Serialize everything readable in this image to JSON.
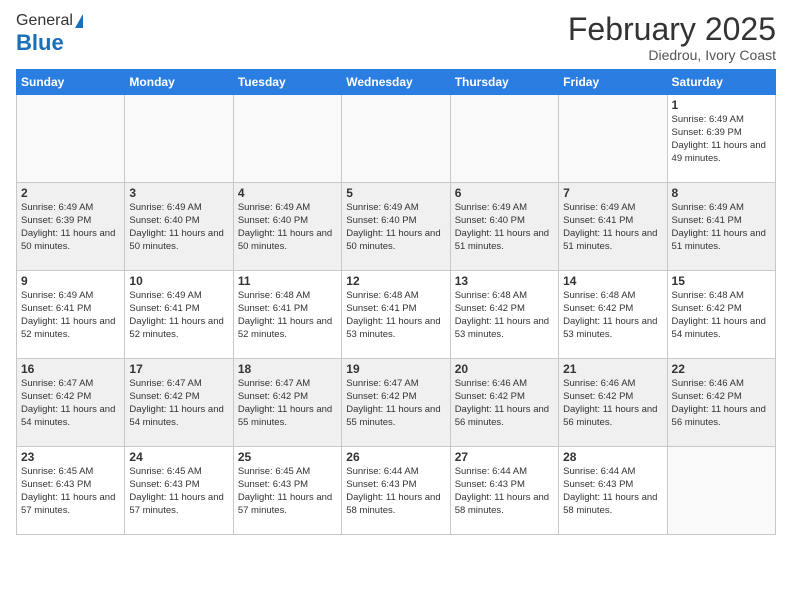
{
  "logo": {
    "general": "General",
    "blue": "Blue"
  },
  "header": {
    "title": "February 2025",
    "subtitle": "Diedrou, Ivory Coast"
  },
  "days_of_week": [
    "Sunday",
    "Monday",
    "Tuesday",
    "Wednesday",
    "Thursday",
    "Friday",
    "Saturday"
  ],
  "weeks": [
    [
      {
        "day": "",
        "info": ""
      },
      {
        "day": "",
        "info": ""
      },
      {
        "day": "",
        "info": ""
      },
      {
        "day": "",
        "info": ""
      },
      {
        "day": "",
        "info": ""
      },
      {
        "day": "",
        "info": ""
      },
      {
        "day": "1",
        "info": "Sunrise: 6:49 AM\nSunset: 6:39 PM\nDaylight: 11 hours and 49 minutes."
      }
    ],
    [
      {
        "day": "2",
        "info": "Sunrise: 6:49 AM\nSunset: 6:39 PM\nDaylight: 11 hours and 50 minutes."
      },
      {
        "day": "3",
        "info": "Sunrise: 6:49 AM\nSunset: 6:40 PM\nDaylight: 11 hours and 50 minutes."
      },
      {
        "day": "4",
        "info": "Sunrise: 6:49 AM\nSunset: 6:40 PM\nDaylight: 11 hours and 50 minutes."
      },
      {
        "day": "5",
        "info": "Sunrise: 6:49 AM\nSunset: 6:40 PM\nDaylight: 11 hours and 50 minutes."
      },
      {
        "day": "6",
        "info": "Sunrise: 6:49 AM\nSunset: 6:40 PM\nDaylight: 11 hours and 51 minutes."
      },
      {
        "day": "7",
        "info": "Sunrise: 6:49 AM\nSunset: 6:41 PM\nDaylight: 11 hours and 51 minutes."
      },
      {
        "day": "8",
        "info": "Sunrise: 6:49 AM\nSunset: 6:41 PM\nDaylight: 11 hours and 51 minutes."
      }
    ],
    [
      {
        "day": "9",
        "info": "Sunrise: 6:49 AM\nSunset: 6:41 PM\nDaylight: 11 hours and 52 minutes."
      },
      {
        "day": "10",
        "info": "Sunrise: 6:49 AM\nSunset: 6:41 PM\nDaylight: 11 hours and 52 minutes."
      },
      {
        "day": "11",
        "info": "Sunrise: 6:48 AM\nSunset: 6:41 PM\nDaylight: 11 hours and 52 minutes."
      },
      {
        "day": "12",
        "info": "Sunrise: 6:48 AM\nSunset: 6:41 PM\nDaylight: 11 hours and 53 minutes."
      },
      {
        "day": "13",
        "info": "Sunrise: 6:48 AM\nSunset: 6:42 PM\nDaylight: 11 hours and 53 minutes."
      },
      {
        "day": "14",
        "info": "Sunrise: 6:48 AM\nSunset: 6:42 PM\nDaylight: 11 hours and 53 minutes."
      },
      {
        "day": "15",
        "info": "Sunrise: 6:48 AM\nSunset: 6:42 PM\nDaylight: 11 hours and 54 minutes."
      }
    ],
    [
      {
        "day": "16",
        "info": "Sunrise: 6:47 AM\nSunset: 6:42 PM\nDaylight: 11 hours and 54 minutes."
      },
      {
        "day": "17",
        "info": "Sunrise: 6:47 AM\nSunset: 6:42 PM\nDaylight: 11 hours and 54 minutes."
      },
      {
        "day": "18",
        "info": "Sunrise: 6:47 AM\nSunset: 6:42 PM\nDaylight: 11 hours and 55 minutes."
      },
      {
        "day": "19",
        "info": "Sunrise: 6:47 AM\nSunset: 6:42 PM\nDaylight: 11 hours and 55 minutes."
      },
      {
        "day": "20",
        "info": "Sunrise: 6:46 AM\nSunset: 6:42 PM\nDaylight: 11 hours and 56 minutes."
      },
      {
        "day": "21",
        "info": "Sunrise: 6:46 AM\nSunset: 6:42 PM\nDaylight: 11 hours and 56 minutes."
      },
      {
        "day": "22",
        "info": "Sunrise: 6:46 AM\nSunset: 6:42 PM\nDaylight: 11 hours and 56 minutes."
      }
    ],
    [
      {
        "day": "23",
        "info": "Sunrise: 6:45 AM\nSunset: 6:43 PM\nDaylight: 11 hours and 57 minutes."
      },
      {
        "day": "24",
        "info": "Sunrise: 6:45 AM\nSunset: 6:43 PM\nDaylight: 11 hours and 57 minutes."
      },
      {
        "day": "25",
        "info": "Sunrise: 6:45 AM\nSunset: 6:43 PM\nDaylight: 11 hours and 57 minutes."
      },
      {
        "day": "26",
        "info": "Sunrise: 6:44 AM\nSunset: 6:43 PM\nDaylight: 11 hours and 58 minutes."
      },
      {
        "day": "27",
        "info": "Sunrise: 6:44 AM\nSunset: 6:43 PM\nDaylight: 11 hours and 58 minutes."
      },
      {
        "day": "28",
        "info": "Sunrise: 6:44 AM\nSunset: 6:43 PM\nDaylight: 11 hours and 58 minutes."
      },
      {
        "day": "",
        "info": ""
      }
    ]
  ]
}
